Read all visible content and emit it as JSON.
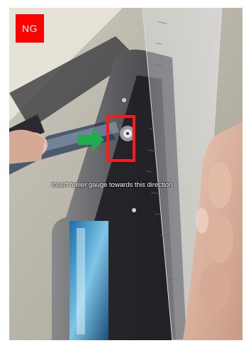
{
  "badge": {
    "label": "NG",
    "color": "#ff0000"
  },
  "caption": {
    "text": "insert feeler gauge towards this direction"
  },
  "arrow": {
    "icon": "arrow-right-icon",
    "color": "#1fae4b"
  },
  "highlight": {
    "icon": "highlight-box",
    "color": "#ff1a1a"
  }
}
